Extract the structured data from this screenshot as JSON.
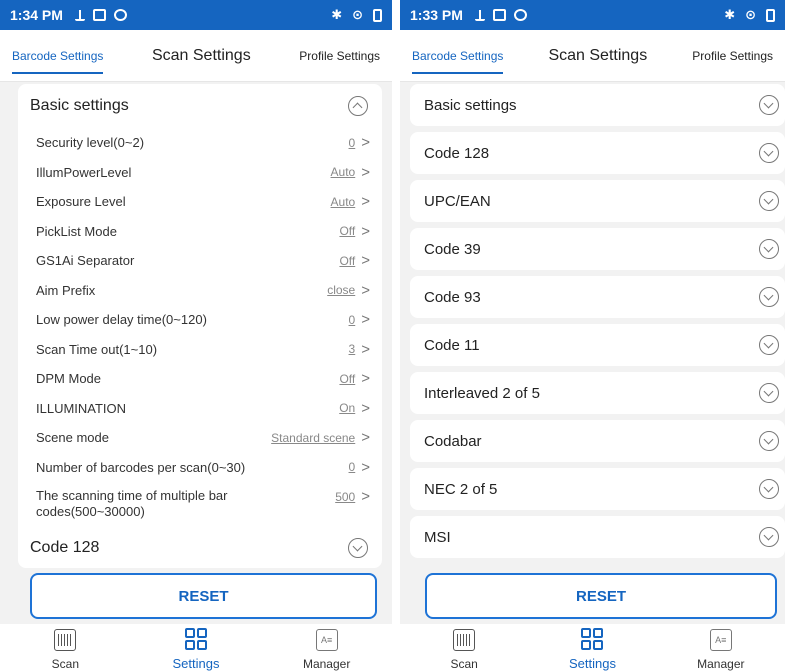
{
  "left": {
    "status": {
      "time": "1:34 PM"
    },
    "tabs": [
      "Barcode Settings",
      "Scan Settings",
      "Profile Settings"
    ],
    "basic_settings": {
      "title": "Basic settings",
      "rows": [
        {
          "label": "Security level(0~2)",
          "value": "0"
        },
        {
          "label": "IllumPowerLevel",
          "value": "Auto"
        },
        {
          "label": "Exposure Level",
          "value": "Auto"
        },
        {
          "label": "PickList Mode",
          "value": "Off"
        },
        {
          "label": "GS1Ai Separator",
          "value": "Off"
        },
        {
          "label": "Aim Prefix",
          "value": "close"
        },
        {
          "label": "Low power delay time(0~120)",
          "value": "0"
        },
        {
          "label": "Scan Time out(1~10)",
          "value": "3"
        },
        {
          "label": "DPM Mode",
          "value": "Off"
        },
        {
          "label": "ILLUMINATION",
          "value": "On"
        },
        {
          "label": "Scene mode",
          "value": "Standard   scene"
        },
        {
          "label": "Number of barcodes per scan(0~30)",
          "value": "0"
        }
      ],
      "tall_row": {
        "label": "The scanning time of multiple bar codes(500~30000)",
        "value": "500"
      }
    },
    "code128": "Code 128",
    "reset": "RESET",
    "nav": {
      "scan": "Scan",
      "settings": "Settings",
      "manager": "Manager"
    }
  },
  "right": {
    "status": {
      "time": "1:33 PM"
    },
    "tabs": [
      "Barcode Settings",
      "Scan Settings",
      "Profile Settings"
    ],
    "sections": [
      "Basic settings",
      "Code 128",
      "UPC/EAN",
      "Code 39",
      "Code 93",
      "Code 11",
      "Interleaved 2 of 5",
      "Codabar",
      "NEC 2 of 5",
      "MSI"
    ],
    "reset": "RESET",
    "nav": {
      "scan": "Scan",
      "settings": "Settings",
      "manager": "Manager"
    }
  }
}
